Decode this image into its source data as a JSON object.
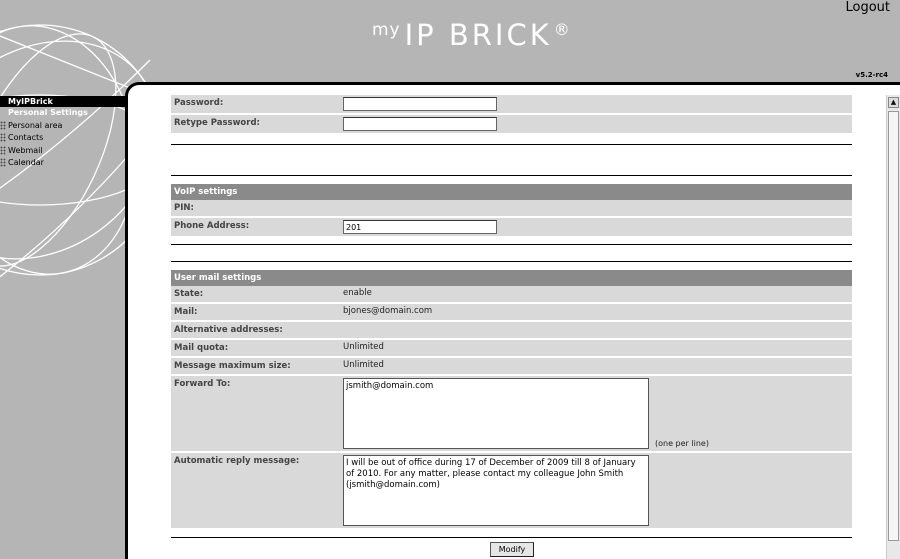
{
  "header": {
    "brand_prefix": "my",
    "brand_name": "IP BRICK",
    "brand_mark": "®",
    "logout_label": "Logout",
    "version": "v5.2-rc4"
  },
  "sidebar": {
    "title": "MyIPBrick",
    "section": "Personal Settings",
    "items": [
      {
        "label": "Personal area"
      },
      {
        "label": "Contacts"
      },
      {
        "label": "Webmail"
      },
      {
        "label": "Calendar"
      }
    ]
  },
  "form": {
    "password_label": "Password:",
    "password_value": "",
    "retype_label": "Retype Password:",
    "retype_value": "",
    "voip": {
      "heading": "VoIP settings",
      "pin_label": "PIN:",
      "pin_value": "",
      "phone_label": "Phone Address:",
      "phone_value": "201"
    },
    "mail": {
      "heading": "User mail settings",
      "state_label": "State:",
      "state_value": "enable",
      "mail_label": "Mail:",
      "mail_value": "bjones@domain.com",
      "alt_label": "Alternative addresses:",
      "alt_value": "",
      "quota_label": "Mail quota:",
      "quota_value": "Unlimited",
      "maxsize_label": "Message maximum size:",
      "maxsize_value": "Unlimited",
      "forward_label": "Forward To:",
      "forward_value": "jsmith@domain.com",
      "forward_hint": "(one per line)",
      "reply_label": "Automatic reply message:",
      "reply_value": "I will be out of office during 17 of December of 2009 till 8 of January of 2010. For any matter, please contact my colleague John Smith (jsmith@domain.com)"
    },
    "modify_label": "Modify"
  },
  "colors": {
    "background": "#b5b5b5",
    "section_header": "#8a8a8a",
    "row": "#d9d9d9"
  }
}
